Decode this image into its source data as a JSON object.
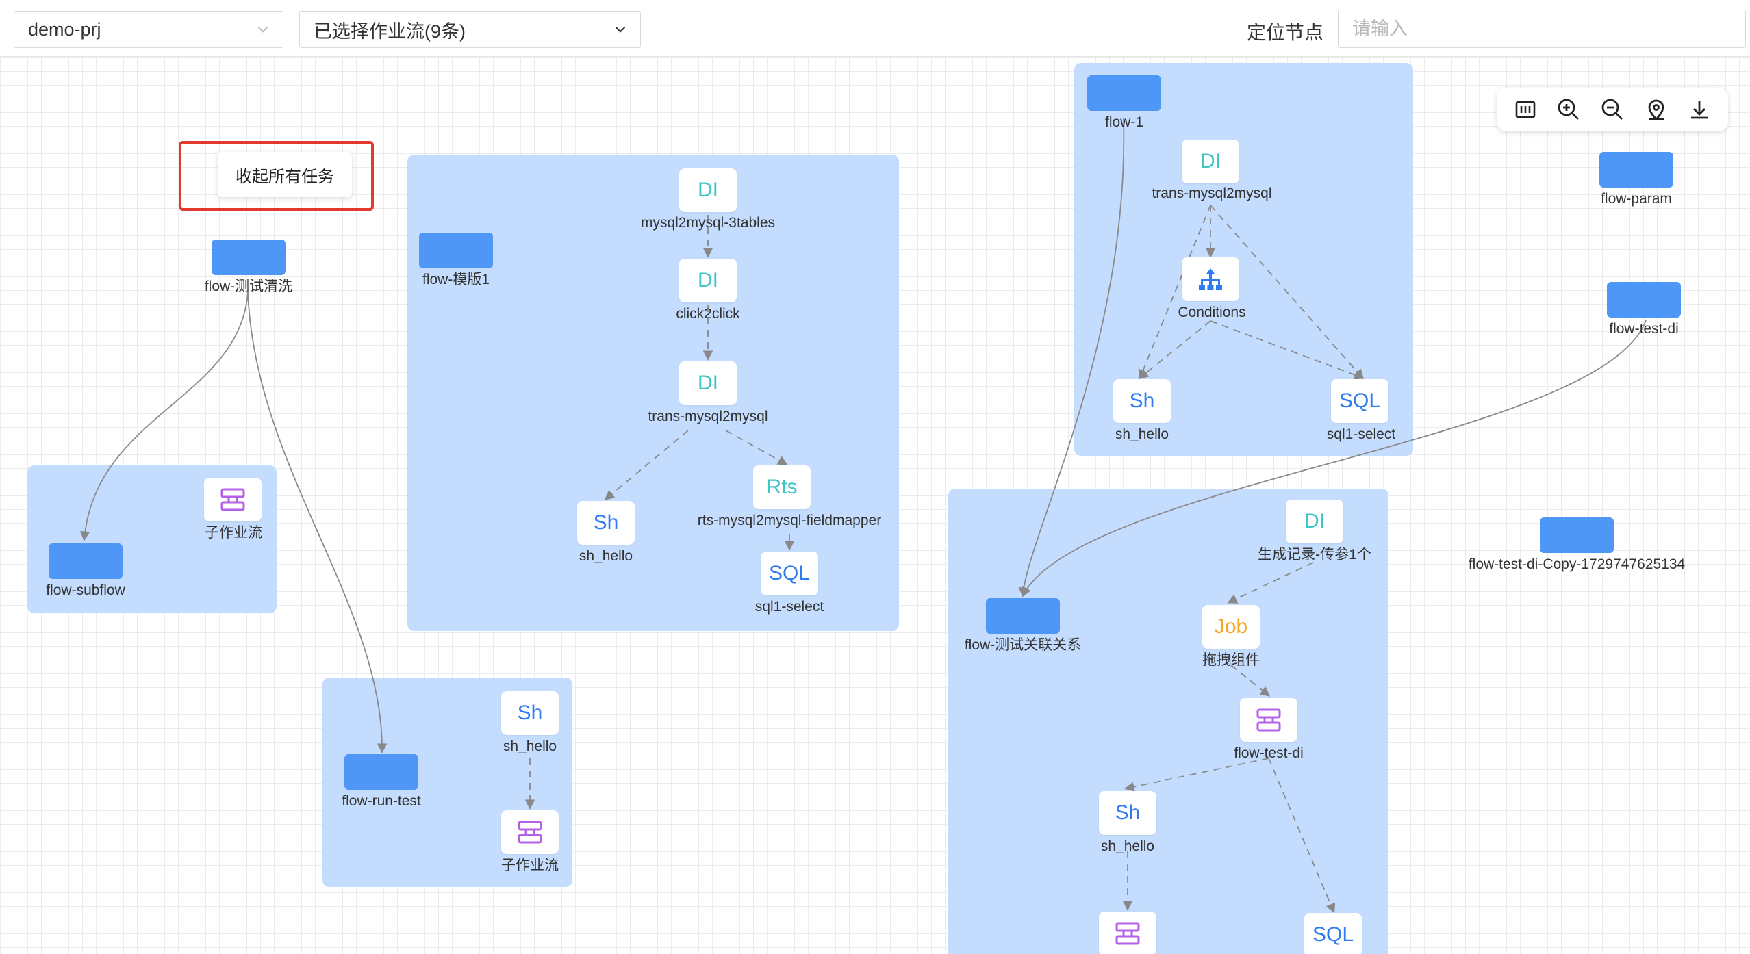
{
  "toolbar": {
    "project": "demo-prj",
    "workflow_select": "已选择作业流(9条)",
    "locate_label": "定位节点",
    "locate_placeholder": "请输入"
  },
  "collapse_button": "收起所有任务",
  "colors": {
    "group_bg": "#c4dcfd",
    "flow_node": "#4e97f7",
    "di": "#3ec5c5",
    "sh_sql": "#2f7bf0",
    "job": "#f5a623",
    "subflow_icon": "#b560e8",
    "highlight_border": "#e23a2e"
  },
  "canvas_tools": [
    "fit-view-icon",
    "zoom-in-icon",
    "zoom-out-icon",
    "locate-icon",
    "download-icon"
  ],
  "flows": {
    "cleanse": "flow-测试清洗",
    "subflow": "flow-subflow",
    "subflow_task": "子作业流",
    "run_test": "flow-run-test",
    "run_test_sh": "sh_hello",
    "run_test_sub": "子作业流",
    "template": "flow-模版1",
    "template_tasks": {
      "t1": "mysql2mysql-3tables",
      "t2": "click2click",
      "t3": "trans-mysql2mysql",
      "t4": "sh_hello",
      "t5": "rts-mysql2mysql-fieldmapper",
      "t6": "sql1-select"
    },
    "flow1": "flow-1",
    "flow1_tasks": {
      "t1": "trans-mysql2mysql",
      "t2": "Conditions",
      "t3": "sh_hello",
      "t4": "sql1-select"
    },
    "param": "flow-param",
    "test_di": "flow-test-di",
    "test_di_copy": "flow-test-di-Copy-1729747625134",
    "relation": "flow-测试关联关系",
    "relation_tasks": {
      "t1": "生成记录-传参1个",
      "t2": "拖拽组件",
      "t3": "flow-test-di",
      "t4": "sh_hello"
    }
  },
  "icon_text": {
    "di": "DI",
    "sh": "Sh",
    "sql": "SQL",
    "rts": "Rts",
    "job": "Job"
  }
}
